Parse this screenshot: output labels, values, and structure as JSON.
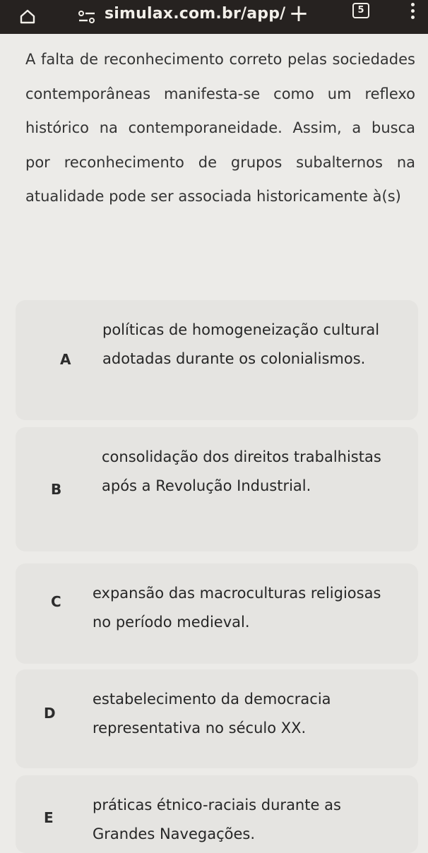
{
  "browser": {
    "url": "simulax.com.br/app/",
    "tab_count": "5",
    "icons": [
      "home-icon",
      "site-info-icon",
      "new-tab-icon",
      "tab-count-icon",
      "menu-icon"
    ]
  },
  "question": {
    "text": "A falta de reconhecimento correto pelas sociedades contemporâneas manifesta-se como um reflexo histórico na contemporaneidade. Assim, a busca por reconhecimento de grupos subalternos na atualidade pode ser associada historicamente à(s)"
  },
  "options": [
    {
      "letter": "A",
      "text": "políticas de homogeneização cultural adotadas durante os colonialismos."
    },
    {
      "letter": "B",
      "text": "consolidação dos direitos trabalhistas após a Revolução Industrial."
    },
    {
      "letter": "C",
      "text": "expansão das macroculturas religiosas no período medieval."
    },
    {
      "letter": "D",
      "text": "estabelecimento da democracia representativa no século XX."
    },
    {
      "letter": "E",
      "text": "práticas étnico-raciais durante as Grandes Navegações."
    }
  ]
}
